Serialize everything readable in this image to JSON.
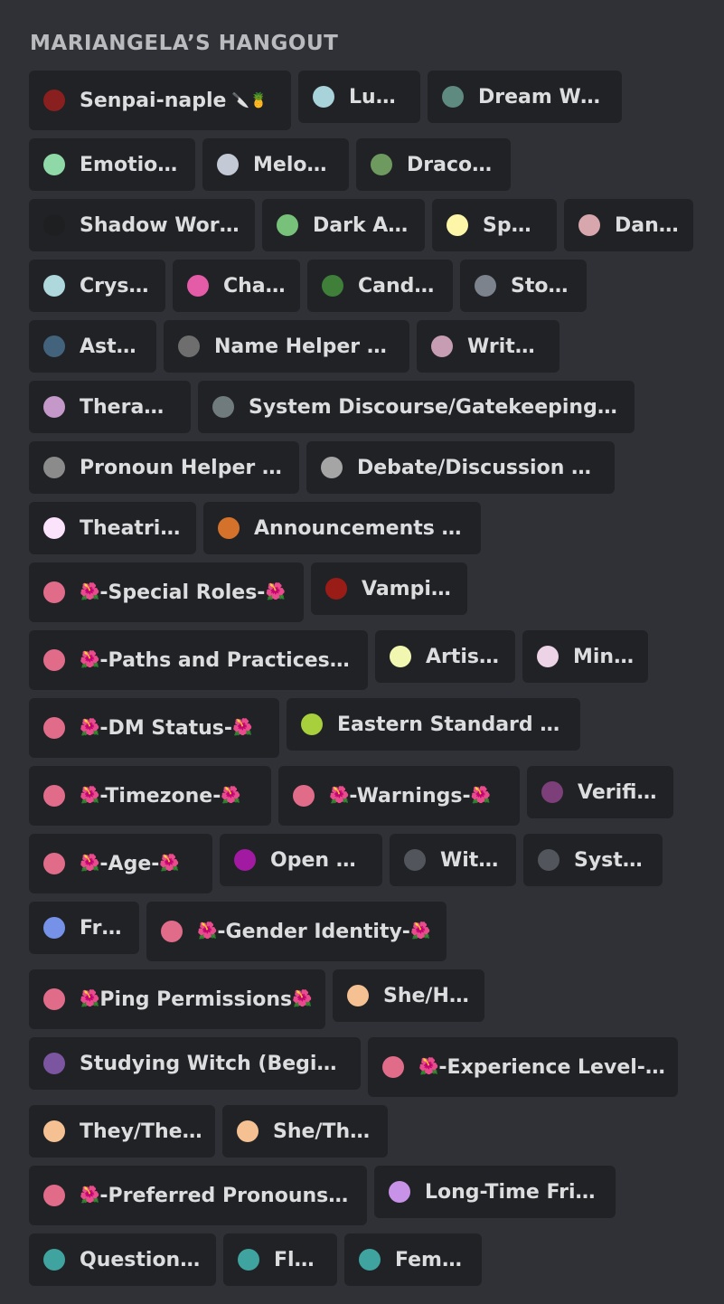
{
  "server_title": "MARIANGELA’S HANGOUT",
  "roles": [
    {
      "label": "Senpai-naple",
      "color": "#8a1f1f",
      "icons": [
        "knife-icon",
        "pineapple-icon"
      ]
    },
    {
      "label": "Lunar",
      "color": "#a9d3db"
    },
    {
      "label": "Dream Work",
      "color": "#5e8a80"
    },
    {
      "label": "Emotional",
      "color": "#8fd9a8"
    },
    {
      "label": "Melodic",
      "color": "#c3cad6"
    },
    {
      "label": "Draconic",
      "color": "#6f9a5f"
    },
    {
      "label": "Shadow Worker",
      "color": "#1e1f21"
    },
    {
      "label": "Dark Arts",
      "color": "#77c17a"
    },
    {
      "label": "Spells",
      "color": "#fdf6a8"
    },
    {
      "label": "Dance",
      "color": "#d8a7ae"
    },
    {
      "label": "Crystal",
      "color": "#aed8dc"
    },
    {
      "label": "Chaos",
      "color": "#e45ba8"
    },
    {
      "label": "Candles",
      "color": "#3f7f3a"
    },
    {
      "label": "Storm",
      "color": "#7c838c"
    },
    {
      "label": "Astral",
      "color": "#43637c"
    },
    {
      "label": "Name Helper Ping",
      "color": "#6e6e6e"
    },
    {
      "label": "Writers",
      "color": "#c69db2"
    },
    {
      "label": "Therapist",
      "color": "#c498c8"
    },
    {
      "label": "System Discourse/Gatekeeping Pin...",
      "color": "#6f7b7d"
    },
    {
      "label": "Pronoun Helper Ping",
      "color": "#8b8b8b"
    },
    {
      "label": "Debate/Discussion Ping",
      "color": "#a5a5a5"
    },
    {
      "label": "Theatrical",
      "color": "#fbe3fb"
    },
    {
      "label": "Announcements Ping",
      "color": "#d4722c"
    },
    {
      "label": "-Special Roles-",
      "color": "#e06c8a",
      "icons": [
        "hibiscus-icon",
        "hibiscus-icon"
      ]
    },
    {
      "label": "Vampiric",
      "color": "#9a1c17"
    },
    {
      "label": "-Paths and Practices-",
      "color": "#e06c8a",
      "icons": [
        "hibiscus-icon",
        "hibiscus-icon"
      ]
    },
    {
      "label": "Artistic",
      "color": "#f1f7b0"
    },
    {
      "label": "Minor",
      "color": "#ecd3e6"
    },
    {
      "label": "-DM Status-",
      "color": "#e06c8a",
      "icons": [
        "hibiscus-icon",
        "hibiscus-icon"
      ]
    },
    {
      "label": "Eastern Standard Time",
      "color": "#a7d03c"
    },
    {
      "label": "-Timezone-",
      "color": "#e06c8a",
      "icons": [
        "hibiscus-icon",
        "hibiscus-icon"
      ]
    },
    {
      "label": "-Warnings-",
      "color": "#e06c8a",
      "icons": [
        "hibiscus-icon",
        "hibiscus-icon"
      ]
    },
    {
      "label": "Verified",
      "color": "#7c3f79"
    },
    {
      "label": "-Age-",
      "color": "#e06c8a",
      "icons": [
        "hibiscus-icon",
        "hibiscus-icon"
      ]
    },
    {
      "label": "Open DM",
      "color": "#a21aa1"
    },
    {
      "label": "Witch",
      "color": "#52555c"
    },
    {
      "label": "System",
      "color": "#52555c"
    },
    {
      "label": "Fren",
      "color": "#7592e8"
    },
    {
      "label": "-Gender Identity-",
      "color": "#e06c8a",
      "icons": [
        "hibiscus-icon",
        "hibiscus-icon"
      ]
    },
    {
      "label": "Ping Permissions",
      "color": "#e06c8a",
      "icons": [
        "hibiscus-icon",
        "hibiscus-icon"
      ]
    },
    {
      "label": "She/Her",
      "color": "#f5c192"
    },
    {
      "label": "Studying Witch (Beginner)",
      "color": "#7c55a0"
    },
    {
      "label": "-Experience Level-",
      "color": "#e06c8a",
      "icons": [
        "hibiscus-icon",
        "hibiscus-icon"
      ]
    },
    {
      "label": "They/Them",
      "color": "#f5c192"
    },
    {
      "label": "She/They",
      "color": "#f5c192"
    },
    {
      "label": "-Preferred Pronouns-",
      "color": "#e06c8a",
      "icons": [
        "hibiscus-icon",
        "hibiscus-icon"
      ]
    },
    {
      "label": "Long-Time Friend",
      "color": "#c792e8"
    },
    {
      "label": "Questioning",
      "color": "#3fa39f"
    },
    {
      "label": "Fluid",
      "color": "#3fa39f"
    },
    {
      "label": "Female",
      "color": "#3fa39f"
    }
  ]
}
